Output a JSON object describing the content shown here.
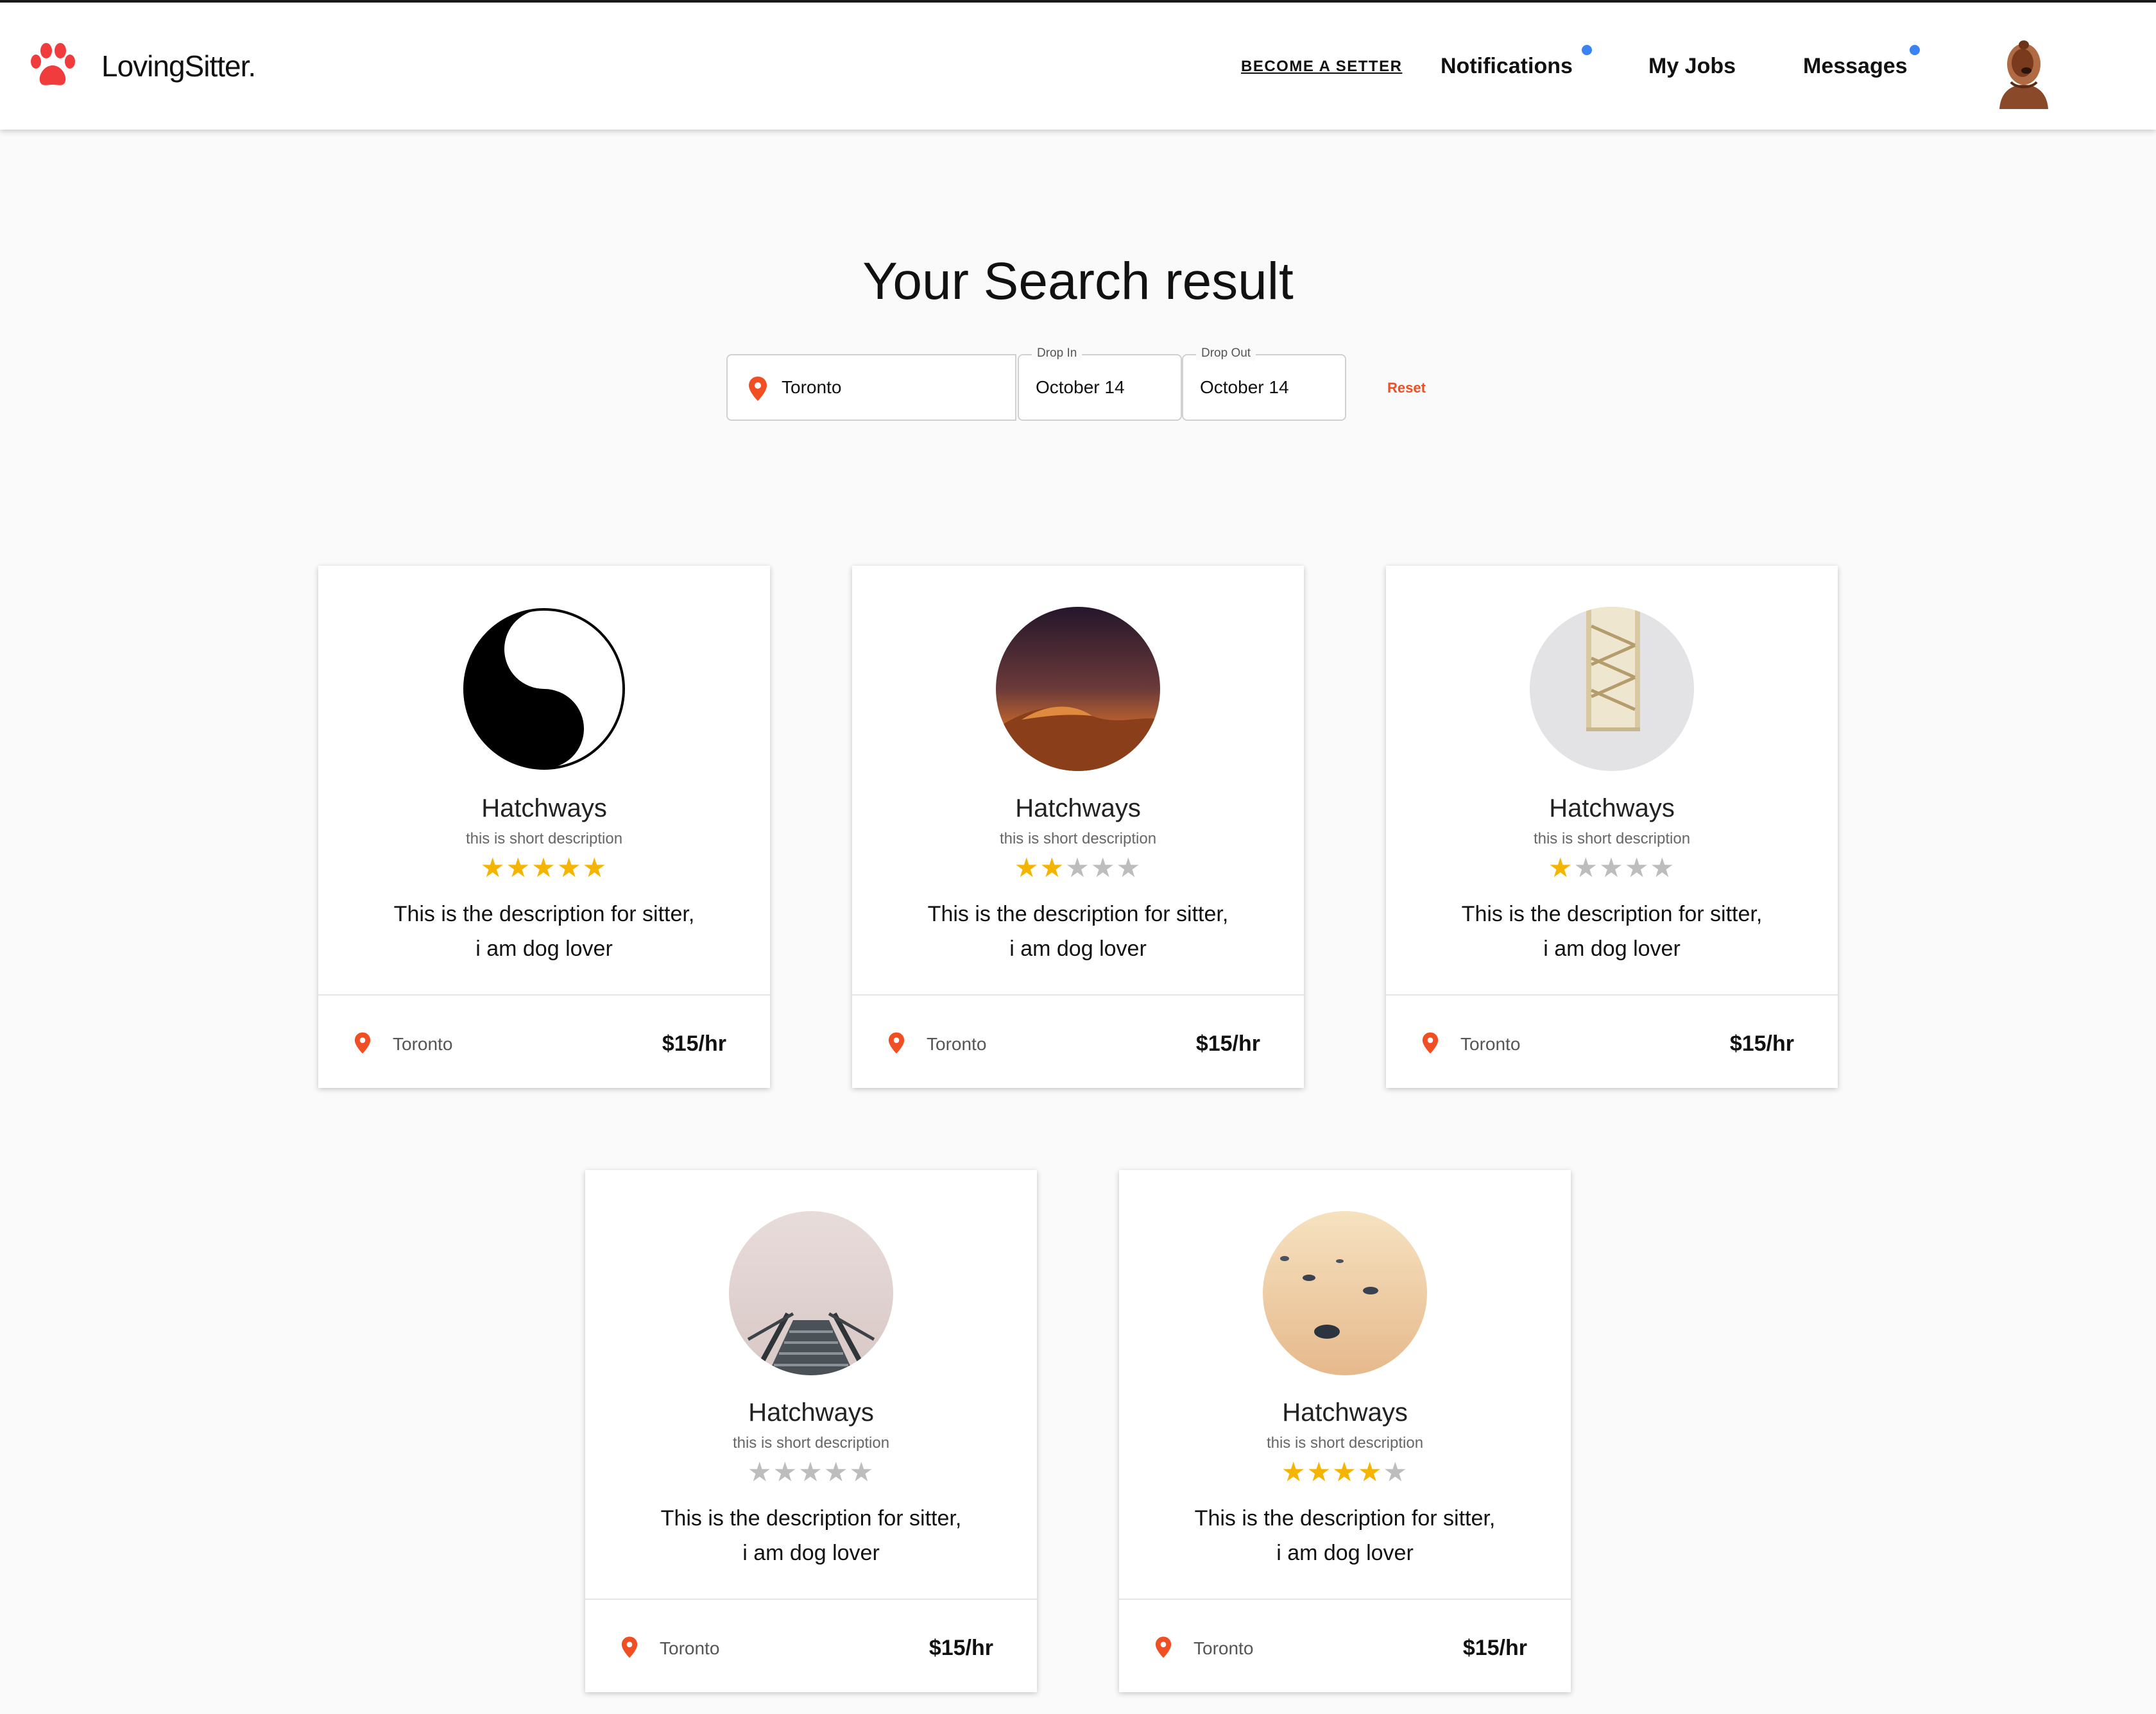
{
  "header": {
    "brand": "LovingSitter.",
    "become_sitter": "BECOME A SETTER",
    "nav": {
      "notifications": "Notifications",
      "my_jobs": "My Jobs",
      "messages": "Messages"
    },
    "indicator_color": "#3b82f6"
  },
  "page": {
    "title": "Your Search result"
  },
  "search": {
    "location": "Toronto",
    "drop_in_label": "Drop In",
    "drop_in_value": "October 14",
    "drop_out_label": "Drop Out",
    "drop_out_value": "October 14",
    "reset_label": "Reset"
  },
  "colors": {
    "accent": "#f04e23",
    "star_filled": "#f5b400",
    "star_empty": "#bdbdbd"
  },
  "results": [
    {
      "name": "Hatchways",
      "short": "this is short description",
      "rating": 5,
      "desc1": "This is the description for sitter,",
      "desc2": "i am dog lover",
      "city": "Toronto",
      "price": "$15/hr",
      "avatar": "yin-yang"
    },
    {
      "name": "Hatchways",
      "short": "this is short description",
      "rating": 2,
      "desc1": "This is the description for sitter,",
      "desc2": "i am dog lover",
      "city": "Toronto",
      "price": "$15/hr",
      "avatar": "desert-dusk"
    },
    {
      "name": "Hatchways",
      "short": "this is short description",
      "rating": 1,
      "desc1": "This is the description for sitter,",
      "desc2": "i am dog lover",
      "city": "Toronto",
      "price": "$15/hr",
      "avatar": "staircase"
    },
    {
      "name": "Hatchways",
      "short": "this is short description",
      "rating": 0,
      "desc1": "This is the description for sitter,",
      "desc2": "i am dog lover",
      "city": "Toronto",
      "price": "$15/hr",
      "avatar": "foggy-stairs"
    },
    {
      "name": "Hatchways",
      "short": "this is short description",
      "rating": 4,
      "desc1": "This is the description for sitter,",
      "desc2": "i am dog lover",
      "city": "Toronto",
      "price": "$15/hr",
      "avatar": "sand-pebbles"
    }
  ]
}
